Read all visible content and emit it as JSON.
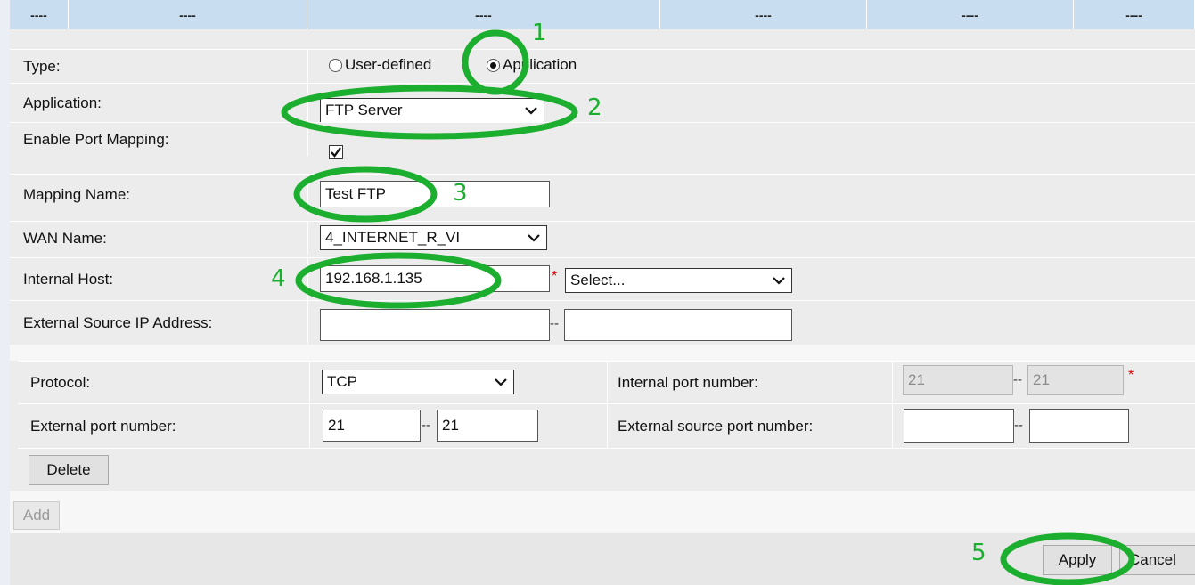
{
  "header": {
    "cells": [
      "----",
      "----",
      "----",
      "----",
      "----",
      "----"
    ]
  },
  "form": {
    "type_label": "Type:",
    "type_options": [
      "User-defined",
      "Application"
    ],
    "type_selected": "Application",
    "application_label": "Application:",
    "application_value": "FTP Server",
    "enable_label": "Enable Port Mapping:",
    "enable_checked": true,
    "mapping_name_label": "Mapping Name:",
    "mapping_name_value": "Test FTP",
    "wan_label": "WAN Name:",
    "wan_value": "4_INTERNET_R_VI",
    "internal_host_label": "Internal Host:",
    "internal_host_value": "192.168.1.135",
    "internal_host_select": "Select...",
    "external_ip_label": "External Source IP Address:",
    "external_ip_start": "",
    "external_ip_end": ""
  },
  "ports": {
    "protocol_label": "Protocol:",
    "protocol_value": "TCP",
    "internal_port_label": "Internal port number:",
    "internal_port_start": "21",
    "internal_port_end": "21",
    "external_port_label": "External port number:",
    "external_port_start": "21",
    "external_port_end": "21",
    "external_source_port_label": "External source port number:",
    "external_source_port_start": "",
    "external_source_port_end": "",
    "delete_label": "Delete"
  },
  "footer": {
    "add_label": "Add",
    "apply_label": "Apply",
    "cancel_label": "Cancel"
  },
  "separators": {
    "range": "--",
    "required": "*"
  },
  "annotations": {
    "step1": "1",
    "step2": "2",
    "step3": "3",
    "step4": "4",
    "step5": "5",
    "color": "#1cae2f"
  },
  "colors": {
    "header_bg": "#c9ddf0",
    "row_bg": "#ececec",
    "required": "#dd0000"
  }
}
